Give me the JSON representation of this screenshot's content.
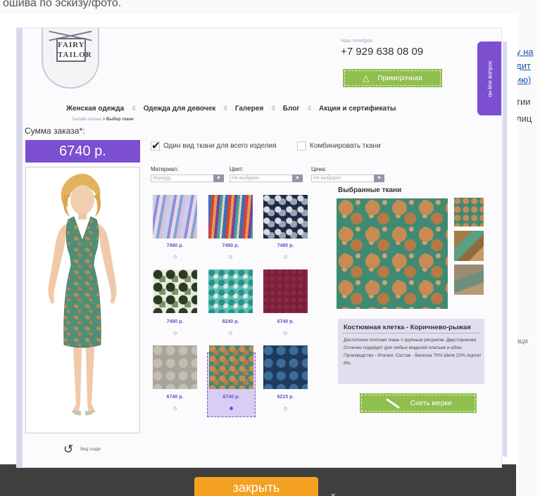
{
  "backdrop": {
    "top_text": "ошива по эскизу/фото.",
    "right_fragments": [
      "у на",
      "дит",
      "ию)",
      "тии",
      "лиц",
      "аци"
    ]
  },
  "logo": {
    "line1": "FAIRY",
    "line2": "TAILOR"
  },
  "header": {
    "phone_label": "Наш телефон",
    "phone": "+7 929 638 08 09",
    "fitting_button": "Примерочная",
    "question_tab": "он-line вопрос"
  },
  "nav": {
    "items": [
      "Женская одежда",
      "Одежда для девочек",
      "Галерея",
      "Блог",
      "Акции и сертификаты"
    ],
    "separator": "4"
  },
  "breadcrumb": {
    "parent": "Онлайн ателье",
    "current": "> Выбор ткани"
  },
  "order": {
    "sum_label": "Сумма заказа*:",
    "sum_value": "6740 р."
  },
  "options": {
    "single_fabric": "Один вид ткани для всего изделия",
    "single_fabric_checked": true,
    "combine_fabrics": "Комбинировать ткани",
    "combine_fabrics_checked": false
  },
  "filters": {
    "material": {
      "label": "Материал:",
      "value": "Жакард"
    },
    "color": {
      "label": "Цвет:",
      "value": "Не выбрано"
    },
    "price": {
      "label": "Цена:",
      "value": "Не выбрано"
    }
  },
  "fabrics": [
    {
      "price": "7490 р.",
      "pattern": "ikat-pastel"
    },
    {
      "price": "7490 р.",
      "pattern": "ikat-bright"
    },
    {
      "price": "7490 р.",
      "pattern": "paisley-navy"
    },
    {
      "price": "7490 р.",
      "pattern": "floral-green"
    },
    {
      "price": "8240 р.",
      "pattern": "paisley-turquoise"
    },
    {
      "price": "6740 р.",
      "pattern": "plain-burgundy"
    },
    {
      "price": "6740 р.",
      "pattern": "paisley-beige"
    },
    {
      "price": "6740 р.",
      "pattern": "paisley-teal-orange",
      "selected": true
    },
    {
      "price": "6215 р.",
      "pattern": "paisley-blue"
    }
  ],
  "selected": {
    "title": "Выбранные ткани",
    "name": "Костюмная клетка - Коричнево-рыжая",
    "description": "Достаточно плотная ткань с крупным рисунком. Двусторонняя. Отлично подойдет для любых моделей платьев и юбок. Производство - Италия. Состав - Вискоза 70% Шелк 22% Ацетат 8%."
  },
  "actions": {
    "measure_button": "Снять мерки",
    "back_view": "Вид сзади",
    "close_button": "закрыть"
  },
  "colors": {
    "accent_purple": "#7b4fd0",
    "button_green": "#8fbf4e",
    "close_orange": "#f4a020",
    "price_purple": "#6d4fc2"
  }
}
